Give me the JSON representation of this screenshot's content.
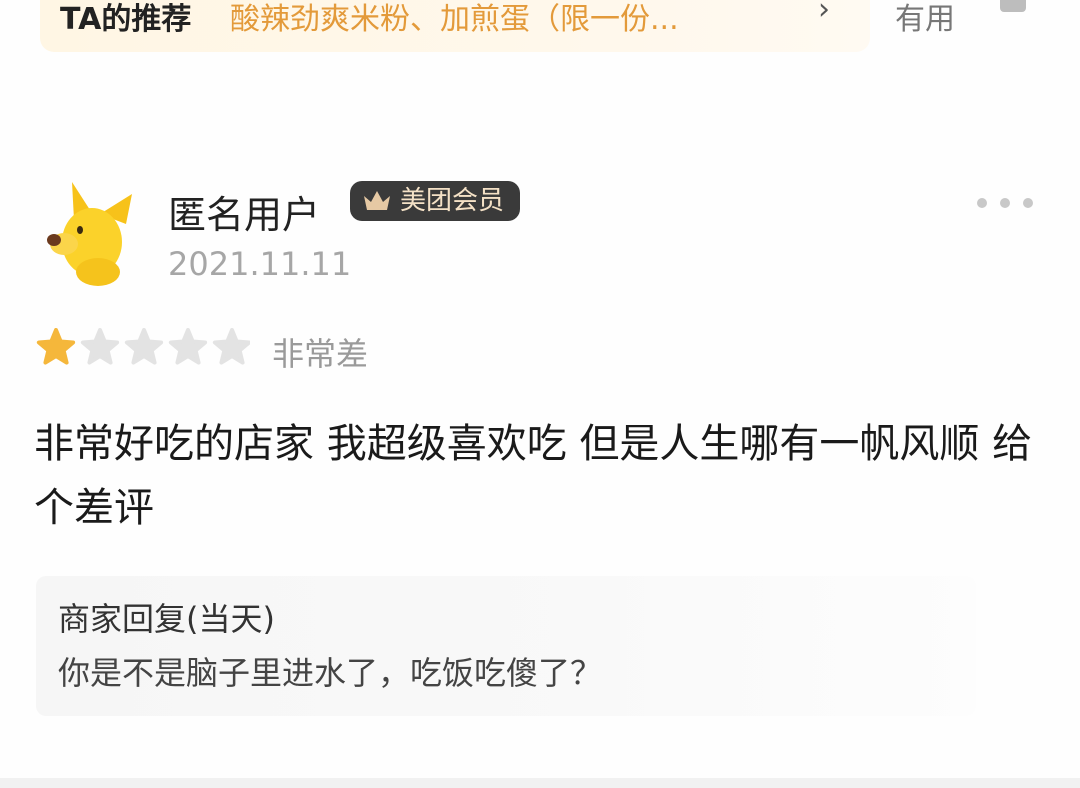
{
  "recommend": {
    "label": "TA的推荐",
    "text": "酸辣劲爽米粉、加煎蛋（限一份...",
    "chevron": "›",
    "helpful_label": "有用"
  },
  "review": {
    "user_name": "匿名用户",
    "member_badge": "美团会员",
    "date": "2021.11.11",
    "rating": 1,
    "rating_max": 5,
    "rating_text": "非常差",
    "body": "非常好吃的店家 我超级喜欢吃 但是人生哪有一帆风顺 给个差评"
  },
  "merchant_reply": {
    "title": "商家回复(当天)",
    "text": "你是不是脑子里进水了，吃饭吃傻了？"
  },
  "colors": {
    "star_active": "#f5b73b",
    "star_inactive": "#e3e3e3",
    "recommend_text": "#e39a3a",
    "badge_bg": "#3a3a3a",
    "badge_text": "#f4e1c6"
  },
  "icons": {
    "avatar": "yellow-dog-avatar",
    "crown": "crown-icon",
    "more": "more-dots-icon",
    "helpful": "thumbs-up-icon",
    "star": "star-icon"
  }
}
